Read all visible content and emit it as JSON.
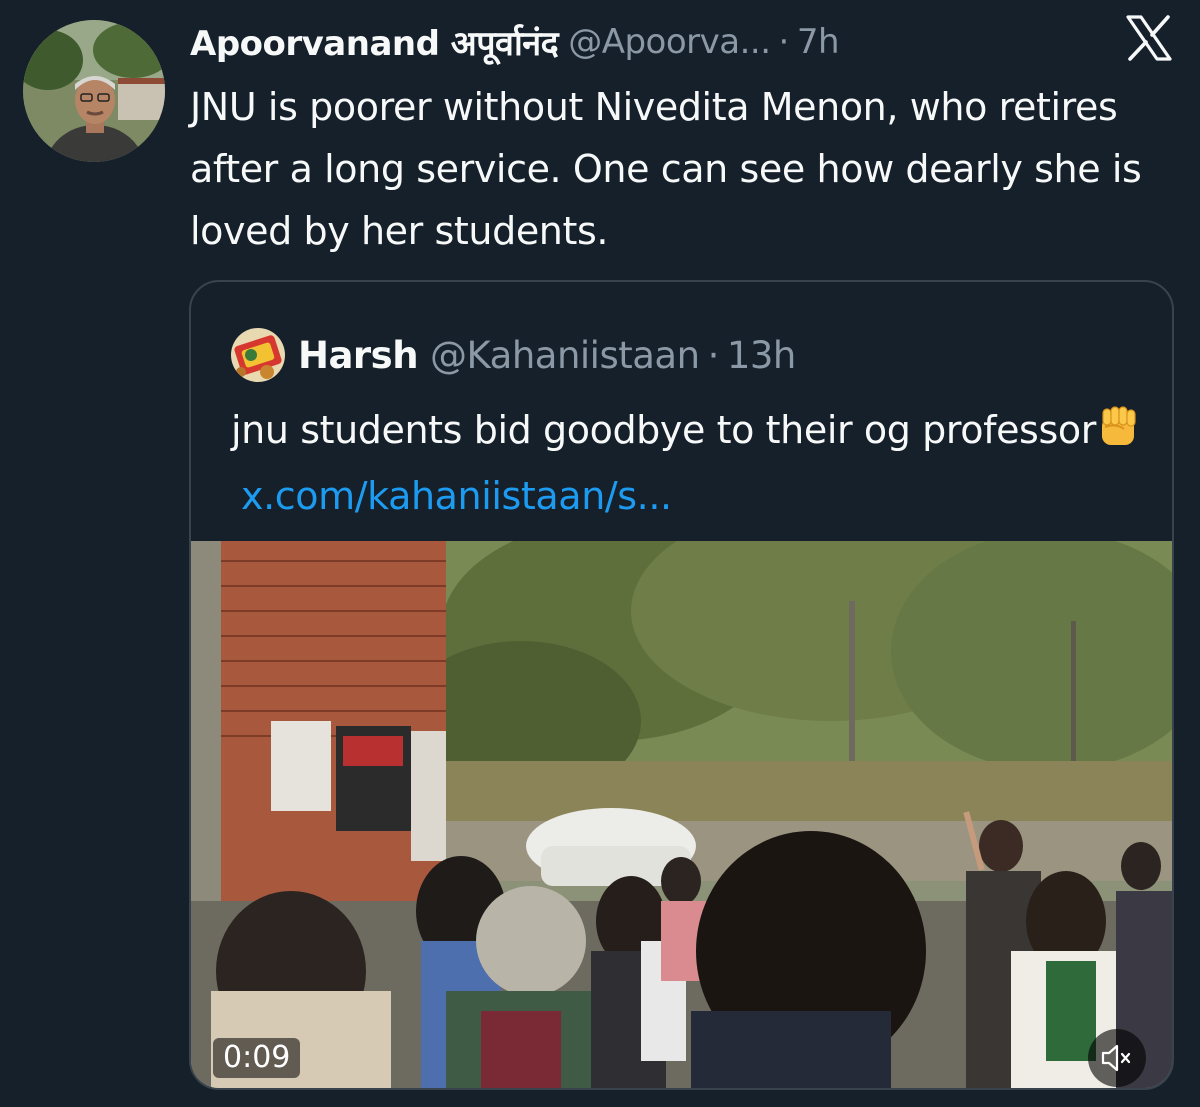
{
  "tweet": {
    "author": {
      "display_name": "Apoorvanand अपूर्वानंद",
      "handle": "@Apoorva...",
      "separator": "·",
      "time": "7h",
      "avatar_icon": "profile-photo"
    },
    "brand_icon": "x-logo-icon",
    "text": "JNU is poorer without Nivedita Menon, who retires after a long service. One can see how dearly she is loved by her students."
  },
  "quoted_tweet": {
    "author": {
      "display_name": "Harsh",
      "handle": "@Kahaniistaan",
      "separator": "·",
      "time": "13h",
      "avatar_icon": "quoted-avatar"
    },
    "text": "jnu students bid goodbye to their og professor",
    "emoji": "raised-fist-emoji",
    "link_text": "x.com/kahaniistaan/s...",
    "video": {
      "duration": "0:09",
      "mute_icon": "speaker-muted-icon"
    }
  },
  "colors": {
    "background": "#15202b",
    "text": "#f7f9f9",
    "secondary_text": "#8b98a5",
    "link": "#1d9bf0",
    "border": "#38444d"
  }
}
